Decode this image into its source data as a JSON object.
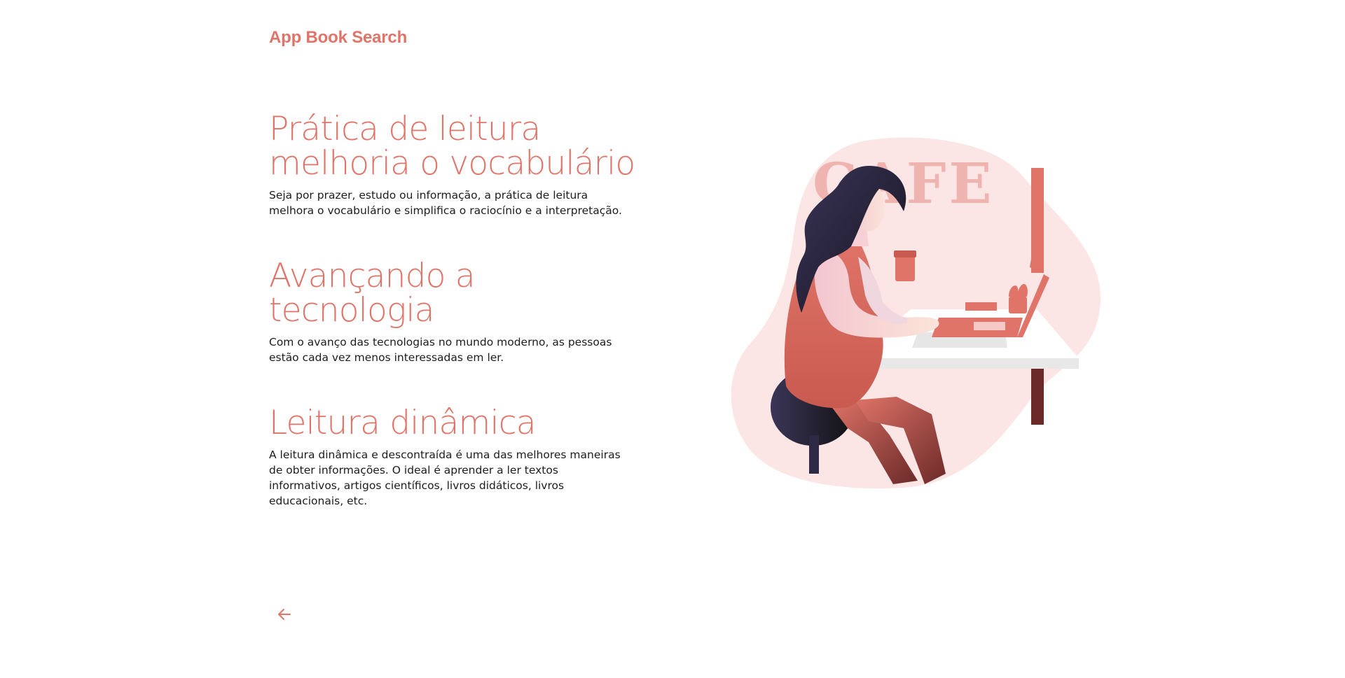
{
  "app": {
    "title": "App Book Search"
  },
  "sections": [
    {
      "heading_line1": "Prática de leitura",
      "heading_line2": "melhoria o vocabulário",
      "body": "Seja por prazer, estudo ou informação, a prática de leitura melhora o vocabulário e simplifica o raciocínio e a interpretação."
    },
    {
      "heading_line1": "Avançando a tecnologia",
      "body": "Com o avanço das tecnologias no mundo moderno, as pessoas estão cada vez menos interessadas em ler."
    },
    {
      "heading_line1": "Leitura dinâmica",
      "body": "A leitura dinâmica e descontraída é uma das melhores maneiras de obter informações. O ideal é aprender a ler textos informativos, artigos científicos, livros didáticos, livros educacionais, etc."
    }
  ],
  "illustration": {
    "sign_text": "CAFE"
  },
  "navigation": {
    "back_icon": "arrow-left-icon"
  },
  "colors": {
    "accent": "#E07468",
    "blob": "#FBE5E5",
    "text": "#1d1d1d",
    "hair": "#2E2A45"
  }
}
